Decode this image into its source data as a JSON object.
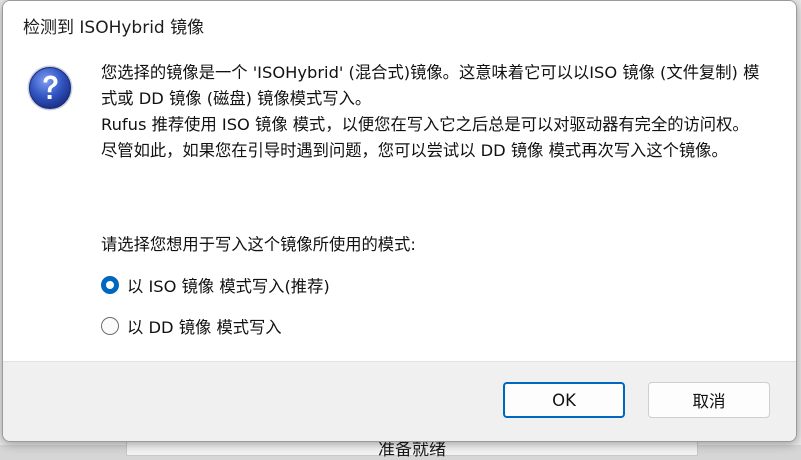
{
  "background_window": {
    "status_text": "准备就绪"
  },
  "dialog": {
    "title": "检测到 ISOHybrid 镜像",
    "icon": "question-icon",
    "message_paragraphs": [
      "您选择的镜像是一个 'ISOHybrid' (混合式)镜像。这意味着它可以以ISO 镜像 (文件复制) 模式或 DD 镜像 (磁盘) 镜像模式写入。",
      "Rufus 推荐使用 ISO 镜像 模式，以便您在写入它之后总是可以对驱动器有完全的访问权。",
      "尽管如此，如果您在引导时遇到问题，您可以尝试以 DD 镜像 模式再次写入这个镜像。"
    ],
    "prompt": "请选择您想用于写入这个镜像所使用的模式:",
    "options": [
      {
        "label": "以 ISO 镜像 模式写入(推荐)",
        "selected": true
      },
      {
        "label": "以 DD 镜像 模式写入",
        "selected": false
      }
    ],
    "buttons": {
      "ok": "OK",
      "cancel": "取消"
    }
  },
  "colors": {
    "accent": "#0067c0",
    "icon_blue": "#2b4fb8",
    "footer_bg": "#f0f0f0"
  }
}
